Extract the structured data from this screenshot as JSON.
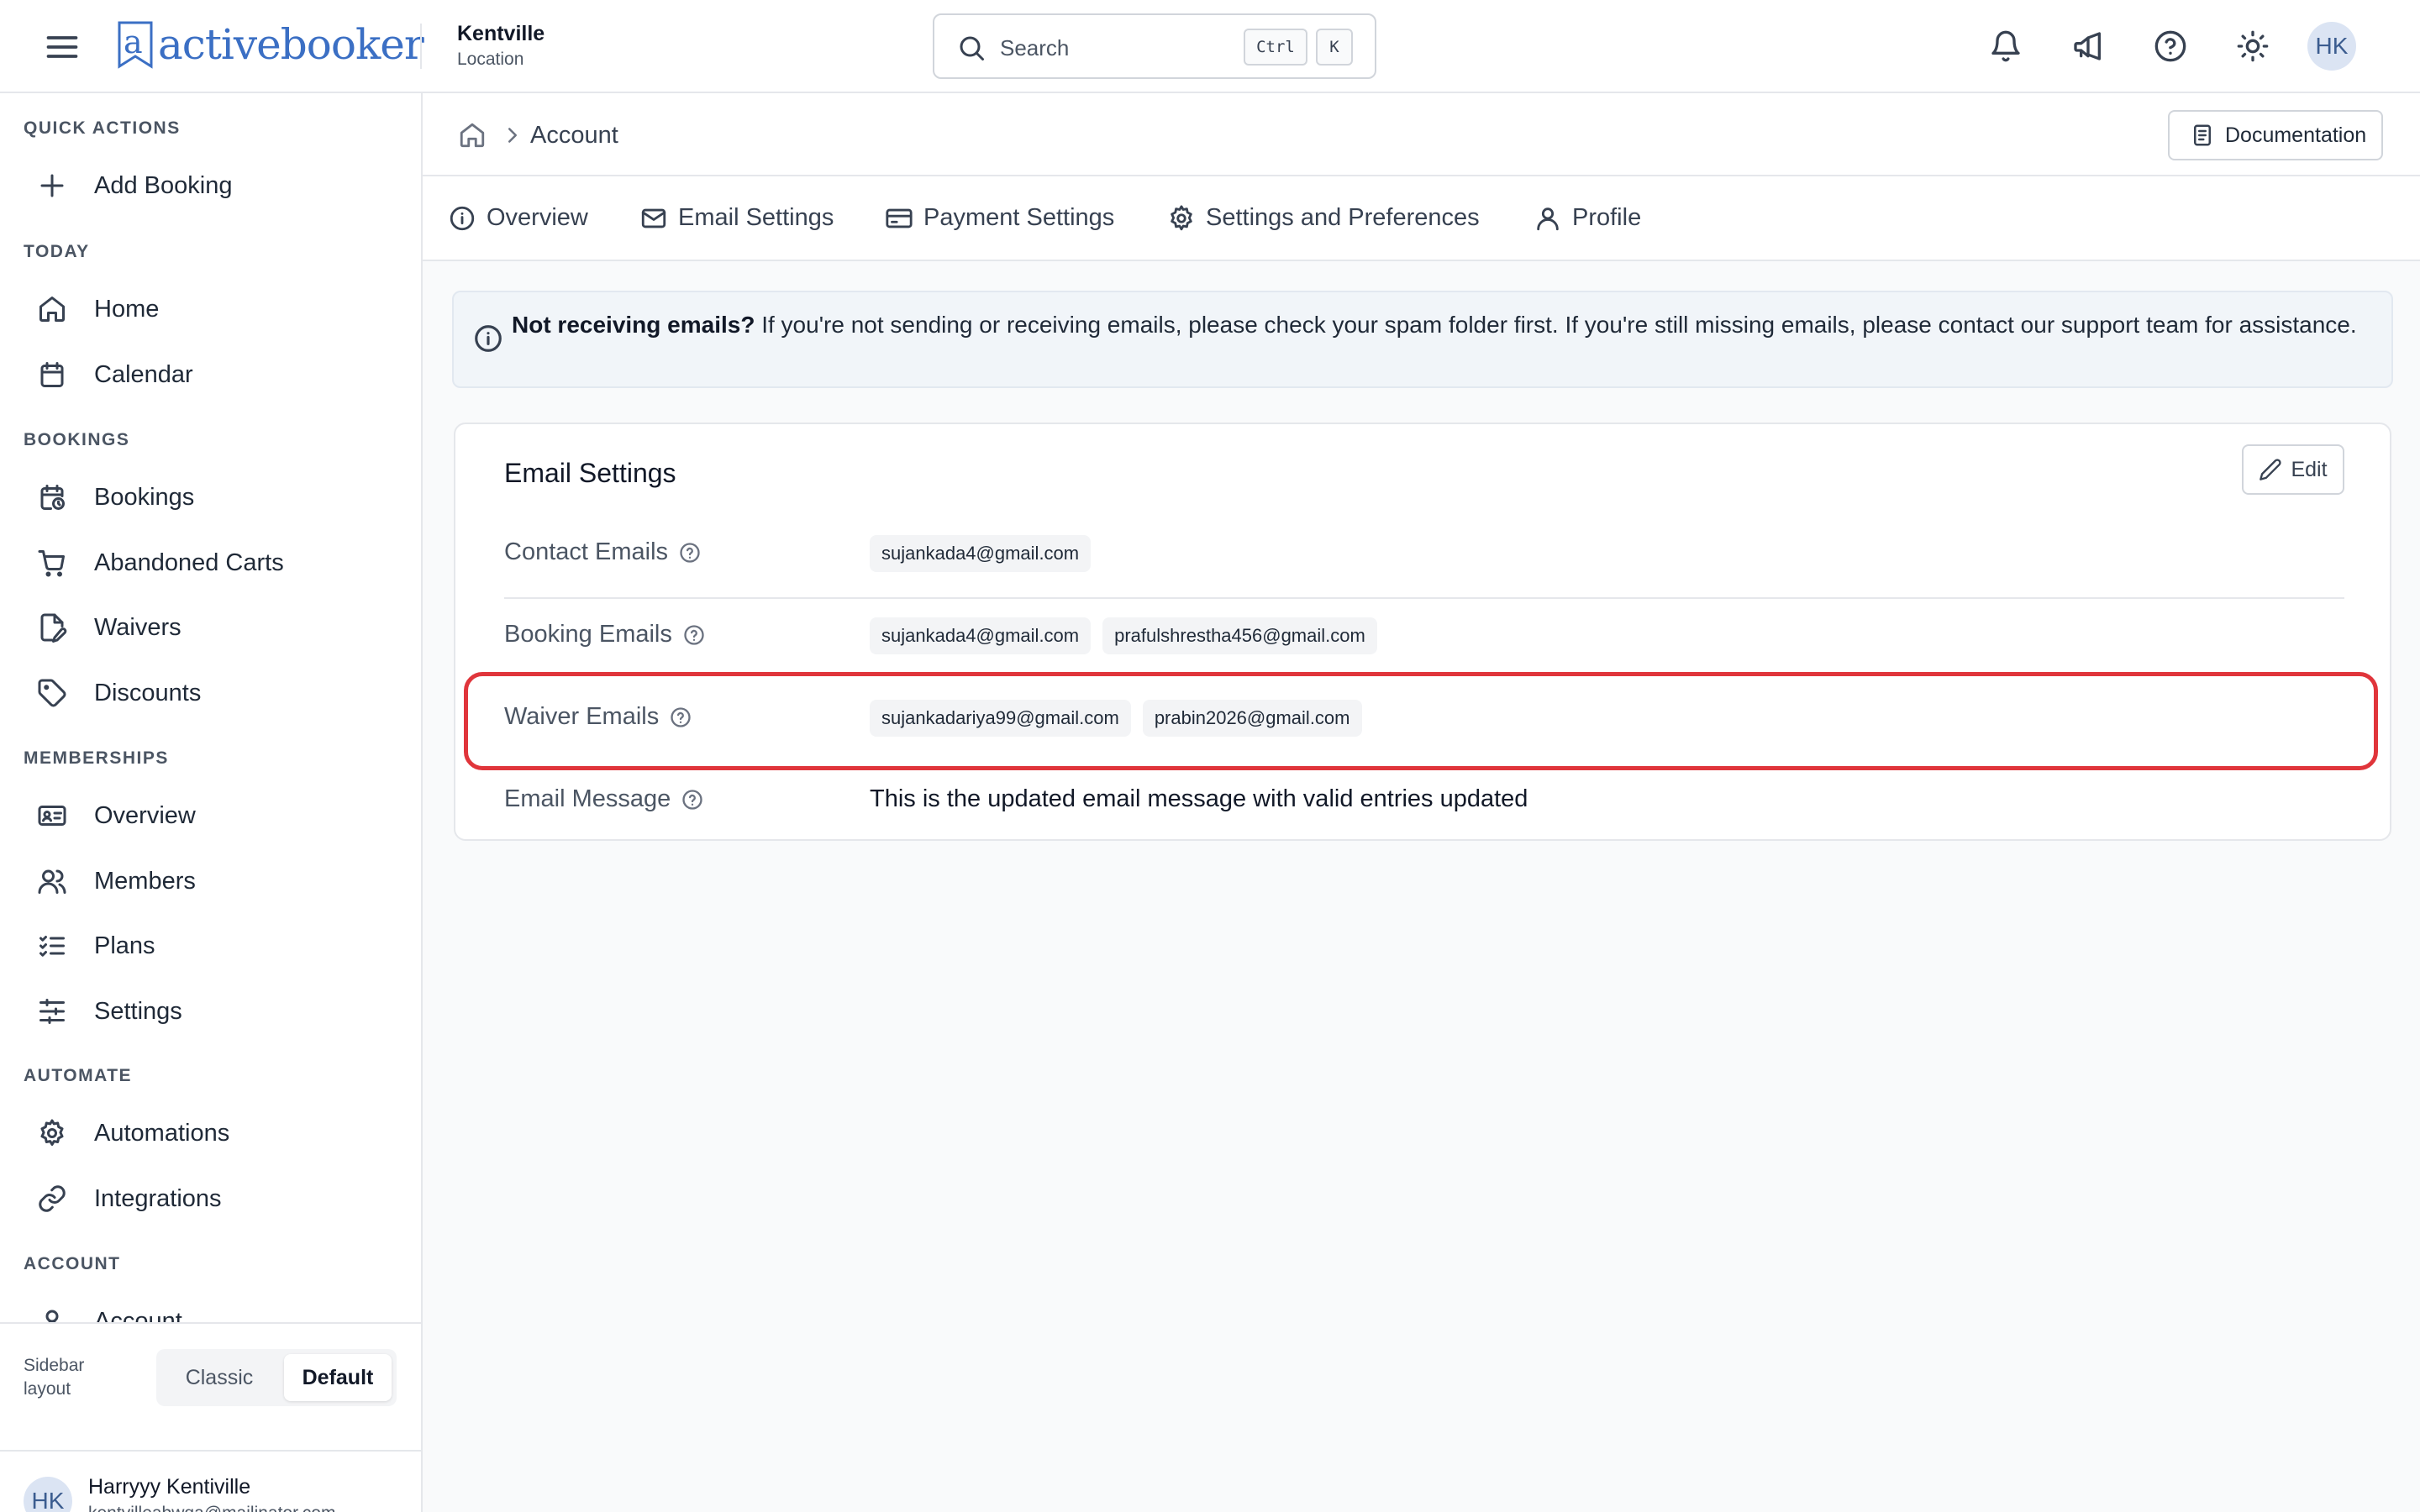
{
  "header": {
    "logo_text": "activebooker",
    "location_name": "Kentville",
    "location_sub": "Location",
    "search_placeholder": "Search",
    "kbd_ctrl": "Ctrl",
    "kbd_k": "K",
    "avatar_initials": "HK"
  },
  "sidebar": {
    "sections": {
      "quick_actions": "QUICK ACTIONS",
      "today": "TODAY",
      "bookings": "BOOKINGS",
      "memberships": "MEMBERSHIPS",
      "automate": "AUTOMATE",
      "account": "ACCOUNT"
    },
    "items": {
      "add_booking": "Add Booking",
      "home": "Home",
      "calendar": "Calendar",
      "bookings": "Bookings",
      "abandoned_carts": "Abandoned Carts",
      "waivers": "Waivers",
      "discounts": "Discounts",
      "overview": "Overview",
      "members": "Members",
      "plans": "Plans",
      "settings": "Settings",
      "automations": "Automations",
      "integrations": "Integrations",
      "account": "Account"
    },
    "layout_label_line1": "Sidebar",
    "layout_label_line2": "layout",
    "layout_classic": "Classic",
    "layout_default": "Default",
    "user": {
      "initials": "HK",
      "name": "Harryyy Kentiville",
      "email": "kentvilleabwqa@mailinator.com"
    }
  },
  "breadcrumb": {
    "current": "Account"
  },
  "documentation_label": "Documentation",
  "tabs": {
    "overview": "Overview",
    "email_settings": "Email Settings",
    "payment_settings": "Payment Settings",
    "settings_preferences": "Settings and Preferences",
    "profile": "Profile"
  },
  "banner": {
    "bold": "Not receiving emails?",
    "text": " If you're not sending or receiving emails, please check your spam folder first. If you're still missing emails, please contact our support team for assistance."
  },
  "card": {
    "title": "Email Settings",
    "edit_label": "Edit",
    "rows": {
      "contact": {
        "label": "Contact Emails",
        "emails": [
          "sujankada4@gmail.com"
        ]
      },
      "booking": {
        "label": "Booking Emails",
        "emails": [
          "sujankada4@gmail.com",
          "prafulshrestha456@gmail.com"
        ]
      },
      "waiver": {
        "label": "Waiver Emails",
        "emails": [
          "sujankadariya99@gmail.com",
          "prabin2026@gmail.com"
        ]
      },
      "message": {
        "label": "Email Message",
        "text": "This is the updated email message with valid entries updated"
      }
    }
  },
  "colors": {
    "brand": "#3b6fc4",
    "highlight": "#e0353b"
  }
}
